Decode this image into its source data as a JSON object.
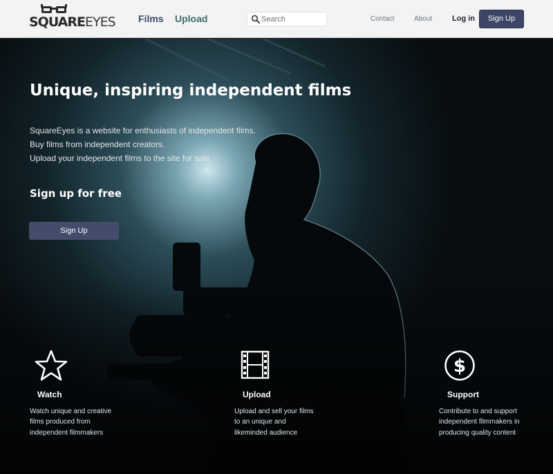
{
  "header": {
    "logo": {
      "bold_text": "SQUARE",
      "thin_text": "EYES"
    },
    "nav": {
      "films": "Films",
      "upload": "Upload"
    },
    "search": {
      "placeholder": "Search",
      "icon": "search-icon"
    },
    "links": {
      "contact": "Contact",
      "about": "About",
      "login": "Log in",
      "signup": "Sign Up"
    }
  },
  "hero": {
    "title": "Unique, inspiring independent films",
    "description": [
      "SquareEyes is a website for enthusiasts of independent films.",
      "Buy films from independent creators.",
      "Upload your independent films to the site for sale."
    ],
    "subtitle": "Sign up for free",
    "signup_label": "Sign Up"
  },
  "features": [
    {
      "icon": "star-icon",
      "title": "Watch",
      "lines": [
        "Watch unique and creative",
        "films produced from",
        "independent filmmakers"
      ]
    },
    {
      "icon": "film-strip-icon",
      "title": "Upload",
      "lines": [
        "Upload and sell your films",
        "to an unique and",
        "likeminded audience"
      ]
    },
    {
      "icon": "dollar-coin-icon",
      "title": "Support",
      "lines": [
        "Contribute to and support",
        "independent filmmakers in",
        "producing quality content"
      ]
    }
  ],
  "colors": {
    "primary": "#3d4566",
    "films_link": "#3c4a6e",
    "upload_link": "#3f6a6c",
    "header_bg": "#f3f3f3",
    "hero_bg": "#0a1013"
  }
}
